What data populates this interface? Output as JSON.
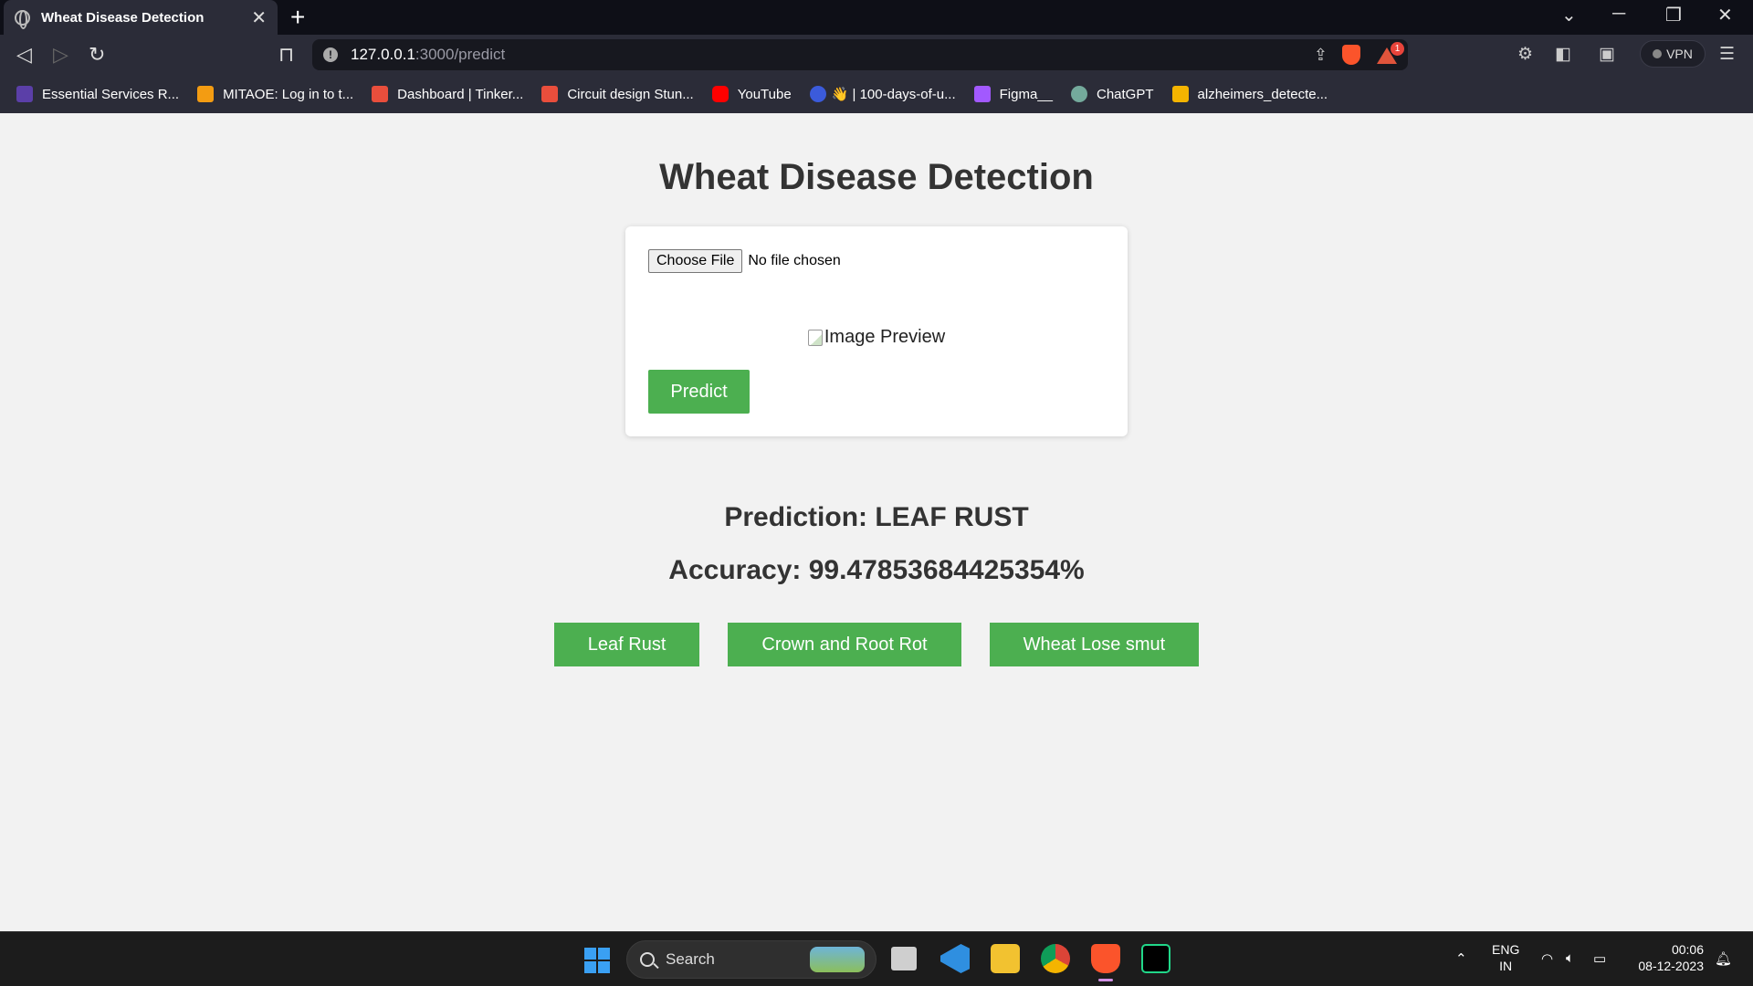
{
  "browser": {
    "tab_title": "Wheat Disease Detection",
    "tab_close": "✕",
    "new_tab": "+",
    "url_host": "127.0.0.1",
    "url_path": ":3000/predict",
    "rewards_badge": "1",
    "vpn_label": "VPN",
    "window_controls": {
      "list": "⌄",
      "minimize": "─",
      "restore": "❐",
      "close": "✕"
    },
    "bookmarks": [
      {
        "label": "Essential Services R...",
        "color": "#5b3fa8"
      },
      {
        "label": "MITAOE: Log in to t...",
        "color": "#f39c12"
      },
      {
        "label": "Dashboard | Tinker...",
        "color": "#e94e3c"
      },
      {
        "label": "Circuit design Stun...",
        "color": "#e94e3c"
      },
      {
        "label": "YouTube",
        "color": "#ff0000"
      },
      {
        "label": "",
        "color": "#3b5bdb"
      },
      {
        "label": "👋 | 100-days-of-u...",
        "color": "#f5c542"
      },
      {
        "label": "Figma__",
        "color": "#a259ff"
      },
      {
        "label": "ChatGPT",
        "color": "#74aa9c"
      },
      {
        "label": "alzheimers_detecte...",
        "color": "#f4b400"
      }
    ]
  },
  "page": {
    "title": "Wheat Disease Detection",
    "file_button": "Choose File",
    "file_status": "No file chosen",
    "preview_alt": "Image Preview",
    "predict_button": "Predict",
    "prediction": "Prediction: LEAF RUST",
    "accuracy": "Accuracy: 99.47853684425354%",
    "disease_buttons": [
      "Leaf Rust",
      "Crown and Root Rot",
      "Wheat Lose smut"
    ]
  },
  "taskbar": {
    "search_label": "Search",
    "lang_line1": "ENG",
    "lang_line2": "IN",
    "time": "00:06",
    "date": "08-12-2023"
  },
  "colors": {
    "accent_green": "#4caf50",
    "page_bg": "#f2f2f2",
    "chrome_bg": "#2b2c38"
  }
}
